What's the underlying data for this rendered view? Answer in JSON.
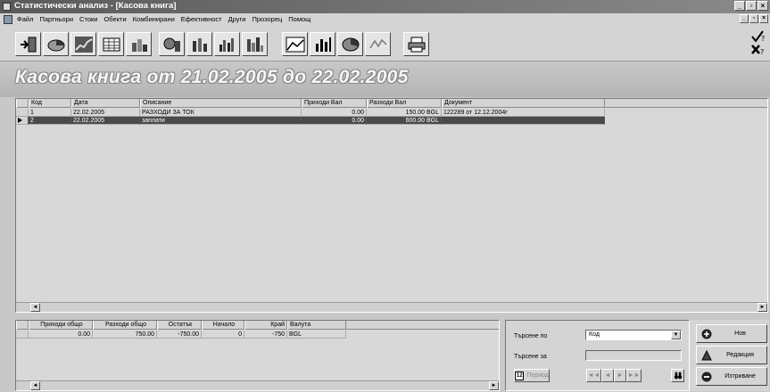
{
  "window": {
    "title": "Статистически анализ - [Касова книга]",
    "minimize": "_",
    "maximize": "▫",
    "close": "×"
  },
  "menu": {
    "items": [
      "Файл",
      "Партньори",
      "Стоки",
      "Обекти",
      "Комбинирани",
      "Ефективност",
      "Други",
      "Прозорец",
      "Помощ"
    ]
  },
  "toolbar": {
    "buttons": [
      "exit-icon",
      "pie-chart-icon",
      "line-trend-icon",
      "table-chart-icon",
      "stacked-bar-icon",
      "pie-bar-icon",
      "bar-3d-icon",
      "bar-group-icon",
      "bar-city-icon",
      "area-chart-icon",
      "column-chart-icon",
      "pie-3d-icon",
      "zigzag-line-icon",
      "printer-icon"
    ],
    "help_icons": [
      "check-help-icon",
      "close-help-icon"
    ]
  },
  "page": {
    "title": "Касова книга от 21.02.2005 до 22.02.2005"
  },
  "grid": {
    "columns": [
      "Код",
      "Дата",
      "Описание",
      "Приходи Вал",
      "Разходи Вал",
      "Документ"
    ],
    "rows": [
      {
        "code": "1",
        "date": "22.02.2005",
        "description": "РАЗХОДИ ЗА ТОК",
        "income": "0.00",
        "expense": "150.00 BGL",
        "document": "122289 от 12.12.2004г"
      },
      {
        "code": "2",
        "date": "22.02.2005",
        "description": "заплати",
        "income": "0.00",
        "expense": "600.00 BGL",
        "document": ""
      }
    ],
    "selected_row": 2,
    "scroll_left": "◄",
    "scroll_right": "►"
  },
  "totals": {
    "columns": [
      "Приходи общо",
      "Разходи общо",
      "Остатък",
      "Начало",
      "Край",
      "Валута"
    ],
    "values": [
      "0.00",
      "750.00",
      "-750.00",
      "0",
      "-750",
      "BGL"
    ]
  },
  "search": {
    "search_by_label": "Търсене по",
    "search_by_value": "Код",
    "search_for_label": "Търсене за",
    "search_for_value": "",
    "period_label": "Период",
    "nav_first": "◄◄",
    "nav_prev": "◄",
    "nav_next": "►",
    "nav_last": "►►"
  },
  "actions": {
    "new": "Нов",
    "edit": "Редакция",
    "delete": "Изтриване"
  }
}
